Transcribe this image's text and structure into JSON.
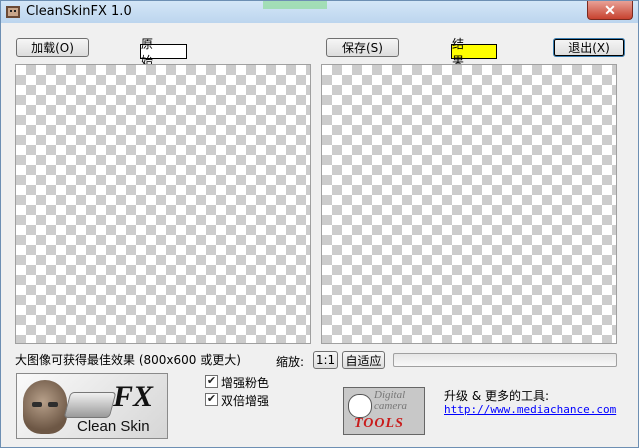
{
  "window": {
    "title": "CleanSkinFX 1.0",
    "close_symbol": "✕"
  },
  "buttons": {
    "load": "加载(O)",
    "save": "保存(S)",
    "exit": "退出(X)",
    "zoom_1to1": "1:1",
    "fit": "自适应"
  },
  "labels": {
    "original": "原 始",
    "result": "结 果",
    "result_bg_color": "#ffff00"
  },
  "status": {
    "hint": "大图像可获得最佳效果 (800x600 或更大)",
    "zoom_label": "缩放:"
  },
  "progress": {
    "value": 0
  },
  "options": [
    {
      "label": "增强粉色",
      "checked": true
    },
    {
      "label": "双倍增强",
      "checked": true
    }
  ],
  "logo": {
    "fx": "FX",
    "name": "Clean Skin"
  },
  "dct_logo": {
    "line1": "Digital",
    "line2": "camera",
    "tools": "TOOLS"
  },
  "promo": {
    "text": "升级 & 更多的工具:",
    "url": "http://www.mediachance.com"
  },
  "colors": {
    "checker_dark": "#cccccc",
    "checker_light": "#ffffff",
    "link": "#0000ff"
  }
}
